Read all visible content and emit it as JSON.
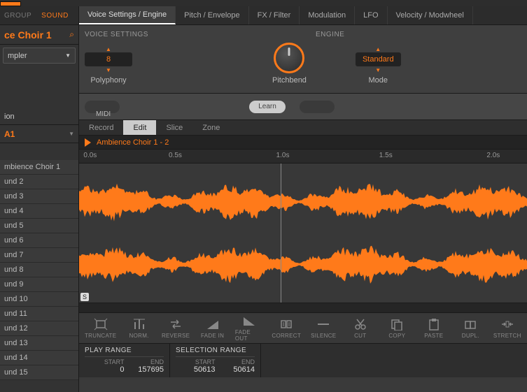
{
  "sidebar": {
    "tabs": {
      "group": "GROUP",
      "sound": "SOUND"
    },
    "title": "ce Choir 1",
    "dropdown": "mpler",
    "section": "ion",
    "channel": "A1",
    "sounds": [
      "mbience Choir 1",
      "und 2",
      "und 3",
      "und 4",
      "und 5",
      "und 6",
      "und 7",
      "und 8",
      "und 9",
      "und 10",
      "und 11",
      "und 12",
      "und 13",
      "und 14",
      "und 15"
    ]
  },
  "tabs": [
    "Voice Settings / Engine",
    "Pitch / Envelope",
    "FX / Filter",
    "Modulation",
    "LFO",
    "Velocity / Modwheel"
  ],
  "voice": {
    "header1": "VOICE SETTINGS",
    "header2": "ENGINE",
    "poly_value": "8",
    "poly_label": "Polyphony",
    "pitch_label": "Pitchbend",
    "mode_value": "Standard",
    "mode_label": "Mode"
  },
  "midi": {
    "learn": "Learn",
    "label": "MIDI"
  },
  "editor": {
    "tabs": [
      "Record",
      "Edit",
      "Slice",
      "Zone"
    ],
    "sample": "Ambience Choir 1 - 2",
    "ruler": [
      "0.0s",
      "0.5s",
      "1.0s",
      "1.5s",
      "2.0s"
    ]
  },
  "tools": [
    "TRUNCATE",
    "NORM.",
    "REVERSE",
    "FADE IN",
    "FADE OUT",
    "CORRECT",
    "SILENCE",
    "CUT",
    "COPY",
    "PASTE",
    "DUPL.",
    "STRETCH"
  ],
  "ranges": {
    "play": {
      "title": "PLAY RANGE",
      "start_lbl": "START",
      "end_lbl": "END",
      "start": "0",
      "end": "157695"
    },
    "sel": {
      "title": "SELECTION RANGE",
      "start_lbl": "START",
      "end_lbl": "END",
      "start": "50613",
      "end": "50614"
    }
  }
}
